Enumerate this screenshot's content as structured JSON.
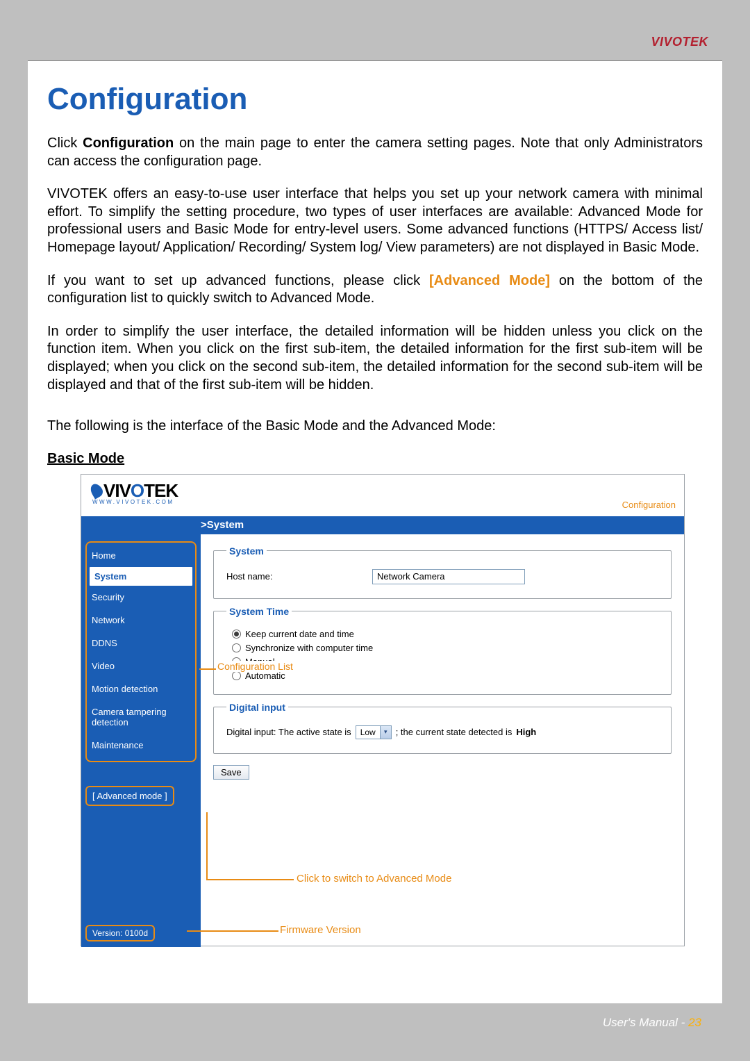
{
  "header": {
    "brand": "VIVOTEK"
  },
  "title": "Configuration",
  "paragraphs": {
    "p1_a": "Click ",
    "p1_b": "Configuration",
    "p1_c": " on the main page to enter the camera setting pages. Note that only Administrators can access the configuration page.",
    "p2": "VIVOTEK offers an easy-to-use user interface that helps you set up your network camera with minimal effort. To simplify the setting procedure, two types of user interfaces are available: Advanced Mode for professional users and Basic Mode for entry-level users. Some advanced functions (HTTPS/ Access list/ Homepage layout/ Application/ Recording/ System log/ View parameters) are not displayed in Basic Mode.",
    "p3_a": "If you want to set up advanced functions, please click ",
    "p3_b": "[Advanced Mode]",
    "p3_c": " on the bottom of the configuration list to quickly switch to Advanced Mode.",
    "p4": "In order to simplify the user interface, the detailed information will be hidden unless you click on the function item. When you click on the first sub-item, the detailed information for the first sub-item will be displayed; when you click on the second sub-item, the detailed information for the second sub-item will be displayed and that of the first sub-item will be hidden.",
    "p5": "The following is the interface of the Basic Mode and the Advanced Mode:"
  },
  "subheading": "Basic Mode",
  "screenshot": {
    "logo_text": "VIV  TEK",
    "logo_sub": "WWW.VIVOTEK.COM",
    "top_link": "Configuration",
    "bar": ">System",
    "nav": {
      "items": [
        "Home",
        "System",
        "Security",
        "Network",
        "DDNS",
        "Video",
        "Motion detection",
        "Camera tampering detection",
        "Maintenance"
      ],
      "current_index": 1,
      "advanced_btn": "[ Advanced mode ]",
      "version": "Version: 0100d"
    },
    "form": {
      "system_legend": "System",
      "hostname_label": "Host name:",
      "hostname_value": "Network Camera",
      "time_legend": "System Time",
      "time_opts": [
        "Keep current date and time",
        "Synchronize with computer time",
        "Manual",
        "Automatic"
      ],
      "time_selected": 0,
      "di_legend": "Digital input",
      "di_line_a": "Digital input: The active state is",
      "di_select": "Low",
      "di_line_b": " ; the current state detected is ",
      "di_state": "High",
      "save": "Save"
    },
    "annot": {
      "cfg_list": "Configuration List",
      "switch": "Click to switch to Advanced Mode",
      "fw": "Firmware Version"
    }
  },
  "footer": {
    "text": "User's Manual - ",
    "page": "23"
  }
}
